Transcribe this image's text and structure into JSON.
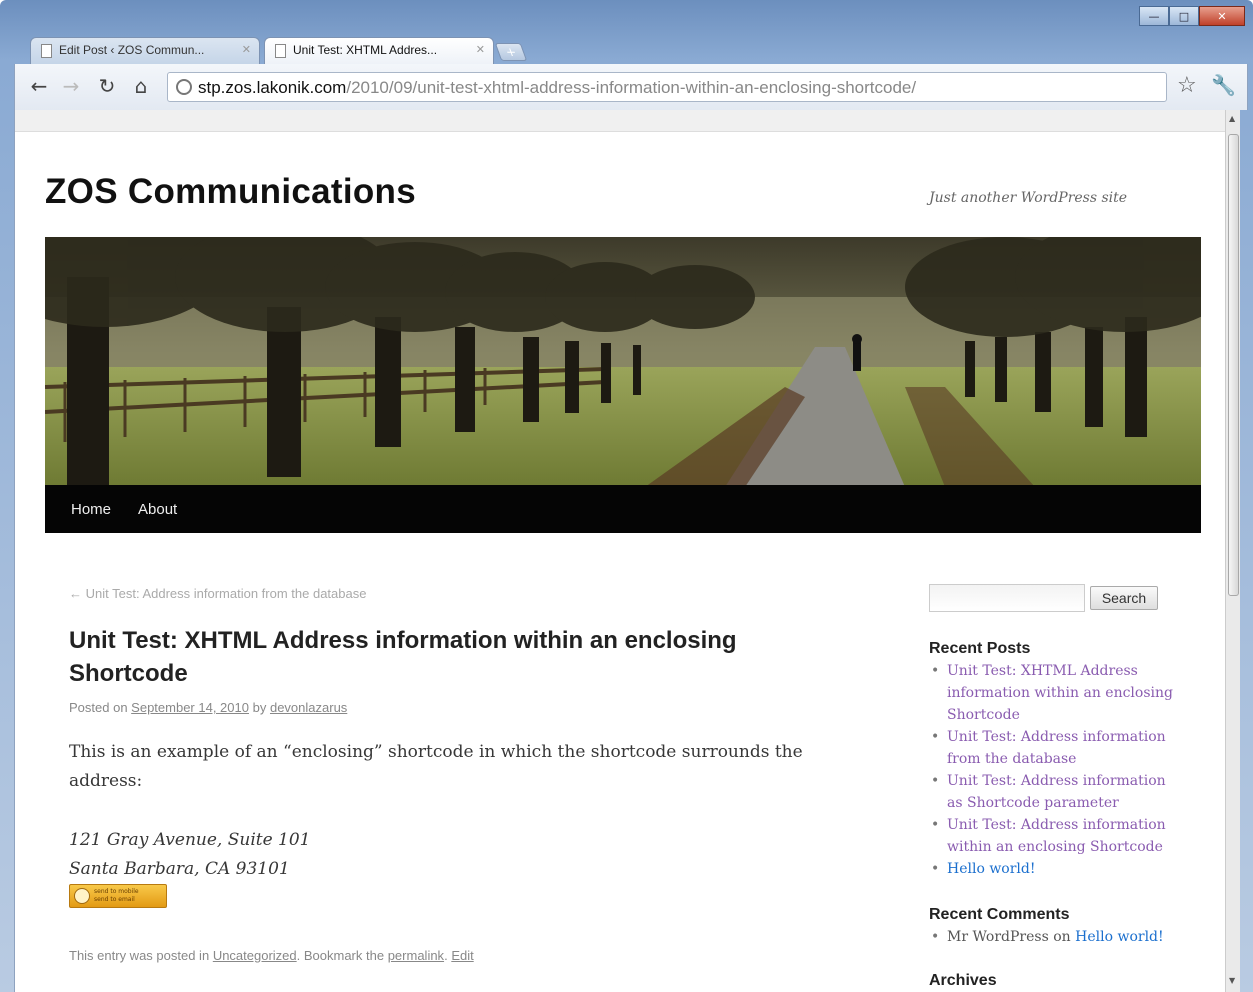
{
  "browser": {
    "tabs": [
      {
        "title": "Edit Post ‹ ZOS Commun...",
        "active": false
      },
      {
        "title": "Unit Test: XHTML Addres...",
        "active": true
      }
    ],
    "url_host": "stp.zos.lakonik.com",
    "url_path": "/2010/09/unit-test-xhtml-address-information-within-an-enclosing-shortcode/",
    "icons": {
      "back": "back-arrow-icon",
      "forward": "forward-arrow-icon",
      "reload": "reload-icon",
      "home": "home-icon",
      "bookmark": "star-icon",
      "menu": "wrench-icon"
    }
  },
  "site": {
    "title": "ZOS Communications",
    "description": "Just another WordPress site",
    "nav": [
      "Home",
      "About"
    ]
  },
  "post": {
    "prev_link": "← Unit Test: Address information from the database",
    "title": "Unit Test: XHTML Address information within an enclosing Shortcode",
    "meta_prefix": "Posted on",
    "date": "September 14, 2010",
    "by": "by",
    "author": "devonlazarus",
    "body": "This is an example of an “enclosing” shortcode in which the shortcode surrounds the address:",
    "address_line1": "121 Gray Avenue, Suite 101",
    "address_line2": "Santa Barbara, CA 93101",
    "badge_line1": "send to mobile",
    "badge_line2": "send to email",
    "footer_prefix": "This entry was posted in",
    "category": "Uncategorized",
    "footer_mid": ". Bookmark the",
    "permalink": "permalink",
    "footer_dot": ".",
    "edit": "Edit"
  },
  "sidebar": {
    "search_button": "Search",
    "recent_posts_title": "Recent Posts",
    "recent_posts": [
      "Unit Test: XHTML Address information within an enclosing Shortcode",
      "Unit Test: Address information from the database",
      "Unit Test: Address information as Shortcode parameter",
      "Unit Test: Address information within an enclosing Shortcode",
      "Hello world!"
    ],
    "recent_comments_title": "Recent Comments",
    "comment_author": "Mr WordPress",
    "comment_on": "on",
    "comment_post": "Hello world!",
    "archives_title": "Archives"
  },
  "colors": {
    "link_visited": "#8a5cb0",
    "link_unvisited": "#1b6fce",
    "navbar": "#050505"
  }
}
